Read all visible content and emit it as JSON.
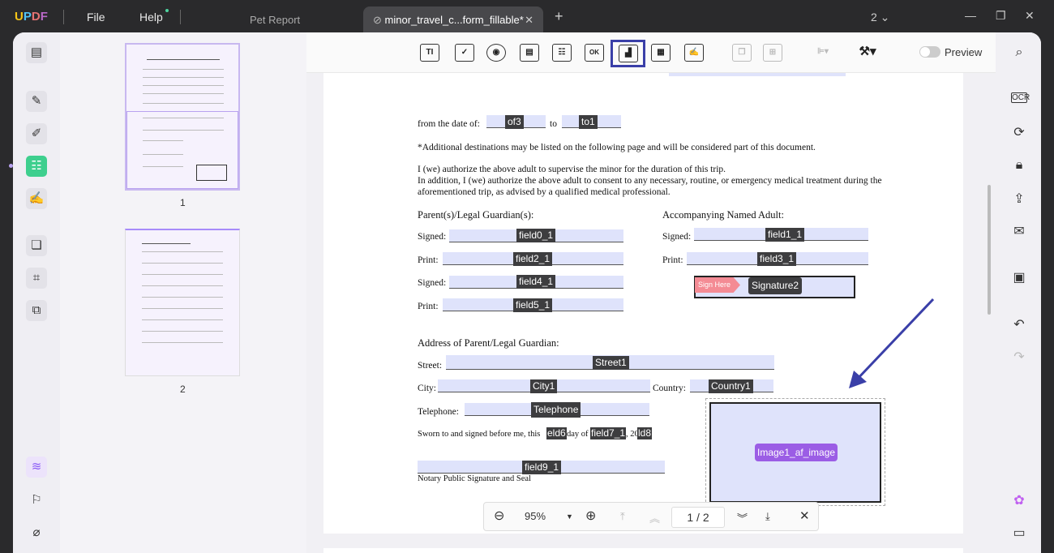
{
  "titlebar": {
    "logo": [
      "U",
      "P",
      "D",
      "F"
    ],
    "menu_file": "File",
    "menu_help": "Help",
    "tab_inactive": "Pet Report",
    "tab_active": "minor_travel_c...form_fillable*",
    "tab_close": "✕",
    "new_tab": "+",
    "window_count": "2",
    "minimize": "—",
    "restore": "❐",
    "close": "✕"
  },
  "toolbar": {
    "text_field": "TI",
    "checkbox": "✓",
    "radio": "◉",
    "dropdown": "▤",
    "listbox": "☷",
    "button": "OK",
    "image": "▟",
    "date": "▦",
    "signature": "✍",
    "preview_label": "Preview"
  },
  "thumbnails": [
    {
      "label": "1"
    },
    {
      "label": "2"
    }
  ],
  "document": {
    "from_date_label": "from the date of:",
    "from_field": "of3",
    "to_label": "to",
    "to_field": "to1",
    "additional_note": "*Additional destinations may be listed on the following page and will be considered part of this document.",
    "authorize_1": "I (we) authorize the above adult to supervise the minor for the duration of this trip.",
    "authorize_2": "In addition, I (we) authorize the above adult to consent to any necessary, routine, or emergency medical treatment during the",
    "authorize_3": "aforementioned trip, as advised by a qualified medical professional.",
    "parent_heading": "Parent(s)/Legal Guardian(s):",
    "adult_heading": "Accompanying Named Adult:",
    "signed": "Signed:",
    "print": "Print:",
    "fields": {
      "f0": "field0_1",
      "f1": "field1_1",
      "f2": "field2_1",
      "f3": "field3_1",
      "f4": "field4_1",
      "f5": "field5_1",
      "sign_here": "Sign Here",
      "sig2": "Signature2"
    },
    "address_heading": "Address of Parent/Legal Guardian:",
    "street_label": "Street:",
    "street": "Street1",
    "city_label": "City:",
    "city": "City1",
    "country_label": "Country:",
    "country": "Country1",
    "telephone_label": "Telephone:",
    "telephone": "Telephone",
    "sworn": "Sworn to and signed before me, this",
    "f6": "eld6",
    "day_of": "day of",
    "f7": "field7_1",
    "twenty": ", 20",
    "f8": "ld8",
    "f9": "field9_1",
    "notary": "Notary Public Signature and Seal",
    "image_field": "Image1_af_image"
  },
  "pager": {
    "zoom": "95%",
    "page": "1 / 2"
  },
  "colors": {
    "accent": "#3a3fa8",
    "field_bg": "#dfe3fb",
    "image_tag": "#9b5de5",
    "sign_here": "#f48b94"
  }
}
